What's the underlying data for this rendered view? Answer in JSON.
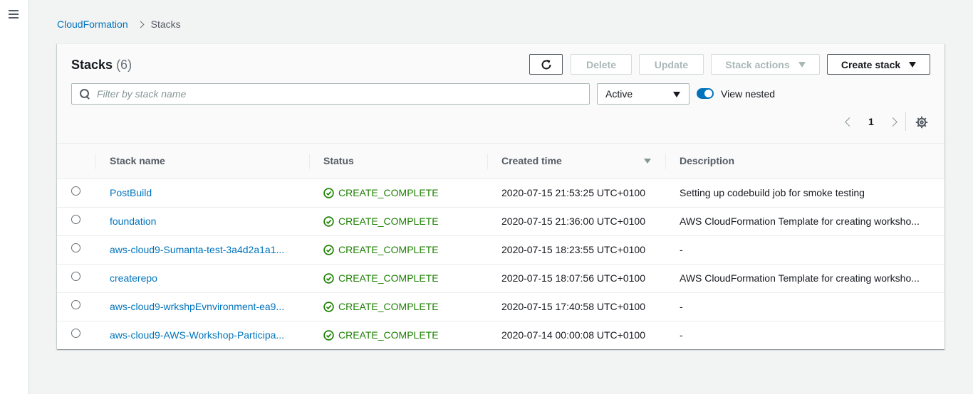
{
  "nav": {
    "menu_icon": "hamburger-menu-icon"
  },
  "breadcrumb": {
    "root": "CloudFormation",
    "current": "Stacks"
  },
  "header": {
    "title": "Stacks",
    "count": "(6)",
    "refresh_icon": "refresh-icon",
    "delete_label": "Delete",
    "update_label": "Update",
    "stack_actions_label": "Stack actions",
    "create_stack_label": "Create stack"
  },
  "filter": {
    "placeholder": "Filter by stack name",
    "status_selected": "Active",
    "view_nested_label": "View nested",
    "view_nested_on": true
  },
  "pagination": {
    "current_page": "1",
    "settings_icon": "gear-icon"
  },
  "table": {
    "columns": [
      "Stack name",
      "Status",
      "Created time",
      "Description"
    ],
    "sorted_column": "Created time",
    "rows": [
      {
        "name": "PostBuild",
        "status": "CREATE_COMPLETE",
        "created": "2020-07-15 21:53:25 UTC+0100",
        "description": "Setting up codebuild job for smoke testing"
      },
      {
        "name": "foundation",
        "status": "CREATE_COMPLETE",
        "created": "2020-07-15 21:36:00 UTC+0100",
        "description": "AWS CloudFormation Template for creating worksho..."
      },
      {
        "name": "aws-cloud9-Sumanta-test-3a4d2a1a1...",
        "status": "CREATE_COMPLETE",
        "created": "2020-07-15 18:23:55 UTC+0100",
        "description": "-"
      },
      {
        "name": "createrepo",
        "status": "CREATE_COMPLETE",
        "created": "2020-07-15 18:07:56 UTC+0100",
        "description": "AWS CloudFormation Template for creating worksho..."
      },
      {
        "name": "aws-cloud9-wrkshpEvnvironment-ea9...",
        "status": "CREATE_COMPLETE",
        "created": "2020-07-15 17:40:58 UTC+0100",
        "description": "-"
      },
      {
        "name": "aws-cloud9-AWS-Workshop-Participa...",
        "status": "CREATE_COMPLETE",
        "created": "2020-07-14 00:00:08 UTC+0100",
        "description": "-"
      }
    ]
  },
  "colors": {
    "link": "#0073bb",
    "success": "#1d8102",
    "toggle": "#0073bb"
  }
}
